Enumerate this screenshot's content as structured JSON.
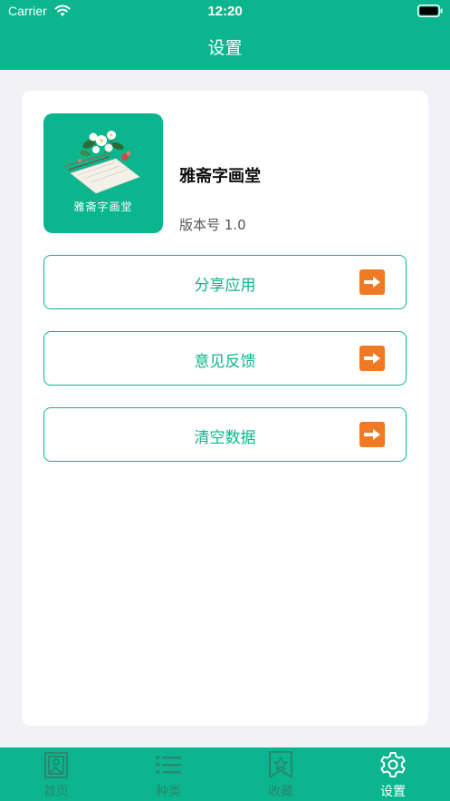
{
  "status_bar": {
    "carrier": "Carrier",
    "time": "12:20"
  },
  "nav": {
    "title": "设置"
  },
  "app": {
    "icon_caption": "雅斋字画堂",
    "name": "雅斋字画堂",
    "version": "版本号 1.0"
  },
  "actions": [
    {
      "label": "分享应用",
      "icon": "arrow-right-icon"
    },
    {
      "label": "意见反馈",
      "icon": "arrow-right-icon"
    },
    {
      "label": "清空数据",
      "icon": "arrow-right-icon"
    }
  ],
  "tabs": [
    {
      "label": "首页",
      "icon": "home-frame-icon",
      "active": false
    },
    {
      "label": "种类",
      "icon": "list-icon",
      "active": false
    },
    {
      "label": "收藏",
      "icon": "bookmark-star-icon",
      "active": false
    },
    {
      "label": "设置",
      "icon": "gear-icon",
      "active": true
    }
  ],
  "colors": {
    "primary": "#0bb58e",
    "accent": "#f07a24",
    "background": "#f2f2f6"
  }
}
